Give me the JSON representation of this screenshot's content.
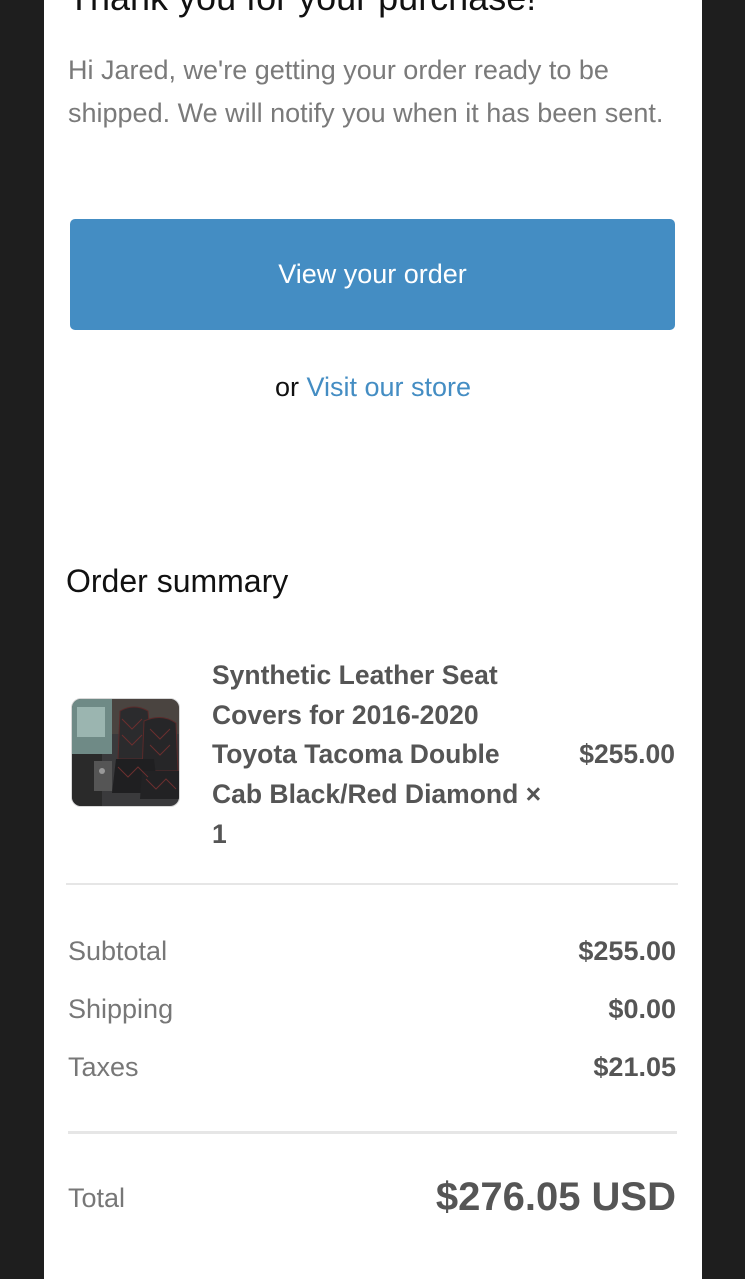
{
  "email": {
    "heading": "Thank you for your purchase!",
    "intro": "Hi Jared, we're getting your order ready to be shipped. We will notify you when it has been sent.",
    "view_order_label": "View your order",
    "or_text": "or",
    "visit_store_label": "Visit our store"
  },
  "order_summary": {
    "title": "Order summary",
    "items": [
      {
        "name": "Synthetic Leather Seat Covers for 2016-2020 Toyota Tacoma Double Cab Black/Red Diamond × 1",
        "price": "$255.00"
      }
    ],
    "subtotal_label": "Subtotal",
    "subtotal_value": "$255.00",
    "shipping_label": "Shipping",
    "shipping_value": "$0.00",
    "taxes_label": "Taxes",
    "taxes_value": "$21.05",
    "total_label": "Total",
    "total_value": "$276.05 USD"
  },
  "colors": {
    "accent": "#448dc3",
    "backdrop": "#1e1e1e",
    "sheet": "#ffffff"
  }
}
